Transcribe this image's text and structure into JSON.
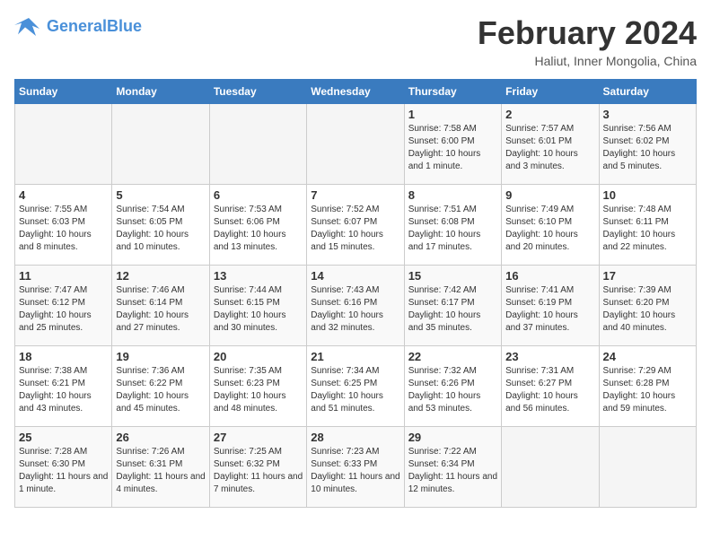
{
  "app": {
    "name": "GeneralBlue",
    "logo_color": "#4a90d9"
  },
  "header": {
    "month": "February 2024",
    "location": "Haliut, Inner Mongolia, China"
  },
  "weekdays": [
    "Sunday",
    "Monday",
    "Tuesday",
    "Wednesday",
    "Thursday",
    "Friday",
    "Saturday"
  ],
  "weeks": [
    [
      {
        "day": "",
        "info": ""
      },
      {
        "day": "",
        "info": ""
      },
      {
        "day": "",
        "info": ""
      },
      {
        "day": "",
        "info": ""
      },
      {
        "day": "1",
        "info": "Sunrise: 7:58 AM\nSunset: 6:00 PM\nDaylight: 10 hours and 1 minute."
      },
      {
        "day": "2",
        "info": "Sunrise: 7:57 AM\nSunset: 6:01 PM\nDaylight: 10 hours and 3 minutes."
      },
      {
        "day": "3",
        "info": "Sunrise: 7:56 AM\nSunset: 6:02 PM\nDaylight: 10 hours and 5 minutes."
      }
    ],
    [
      {
        "day": "4",
        "info": "Sunrise: 7:55 AM\nSunset: 6:03 PM\nDaylight: 10 hours and 8 minutes."
      },
      {
        "day": "5",
        "info": "Sunrise: 7:54 AM\nSunset: 6:05 PM\nDaylight: 10 hours and 10 minutes."
      },
      {
        "day": "6",
        "info": "Sunrise: 7:53 AM\nSunset: 6:06 PM\nDaylight: 10 hours and 13 minutes."
      },
      {
        "day": "7",
        "info": "Sunrise: 7:52 AM\nSunset: 6:07 PM\nDaylight: 10 hours and 15 minutes."
      },
      {
        "day": "8",
        "info": "Sunrise: 7:51 AM\nSunset: 6:08 PM\nDaylight: 10 hours and 17 minutes."
      },
      {
        "day": "9",
        "info": "Sunrise: 7:49 AM\nSunset: 6:10 PM\nDaylight: 10 hours and 20 minutes."
      },
      {
        "day": "10",
        "info": "Sunrise: 7:48 AM\nSunset: 6:11 PM\nDaylight: 10 hours and 22 minutes."
      }
    ],
    [
      {
        "day": "11",
        "info": "Sunrise: 7:47 AM\nSunset: 6:12 PM\nDaylight: 10 hours and 25 minutes."
      },
      {
        "day": "12",
        "info": "Sunrise: 7:46 AM\nSunset: 6:14 PM\nDaylight: 10 hours and 27 minutes."
      },
      {
        "day": "13",
        "info": "Sunrise: 7:44 AM\nSunset: 6:15 PM\nDaylight: 10 hours and 30 minutes."
      },
      {
        "day": "14",
        "info": "Sunrise: 7:43 AM\nSunset: 6:16 PM\nDaylight: 10 hours and 32 minutes."
      },
      {
        "day": "15",
        "info": "Sunrise: 7:42 AM\nSunset: 6:17 PM\nDaylight: 10 hours and 35 minutes."
      },
      {
        "day": "16",
        "info": "Sunrise: 7:41 AM\nSunset: 6:19 PM\nDaylight: 10 hours and 37 minutes."
      },
      {
        "day": "17",
        "info": "Sunrise: 7:39 AM\nSunset: 6:20 PM\nDaylight: 10 hours and 40 minutes."
      }
    ],
    [
      {
        "day": "18",
        "info": "Sunrise: 7:38 AM\nSunset: 6:21 PM\nDaylight: 10 hours and 43 minutes."
      },
      {
        "day": "19",
        "info": "Sunrise: 7:36 AM\nSunset: 6:22 PM\nDaylight: 10 hours and 45 minutes."
      },
      {
        "day": "20",
        "info": "Sunrise: 7:35 AM\nSunset: 6:23 PM\nDaylight: 10 hours and 48 minutes."
      },
      {
        "day": "21",
        "info": "Sunrise: 7:34 AM\nSunset: 6:25 PM\nDaylight: 10 hours and 51 minutes."
      },
      {
        "day": "22",
        "info": "Sunrise: 7:32 AM\nSunset: 6:26 PM\nDaylight: 10 hours and 53 minutes."
      },
      {
        "day": "23",
        "info": "Sunrise: 7:31 AM\nSunset: 6:27 PM\nDaylight: 10 hours and 56 minutes."
      },
      {
        "day": "24",
        "info": "Sunrise: 7:29 AM\nSunset: 6:28 PM\nDaylight: 10 hours and 59 minutes."
      }
    ],
    [
      {
        "day": "25",
        "info": "Sunrise: 7:28 AM\nSunset: 6:30 PM\nDaylight: 11 hours and 1 minute."
      },
      {
        "day": "26",
        "info": "Sunrise: 7:26 AM\nSunset: 6:31 PM\nDaylight: 11 hours and 4 minutes."
      },
      {
        "day": "27",
        "info": "Sunrise: 7:25 AM\nSunset: 6:32 PM\nDaylight: 11 hours and 7 minutes."
      },
      {
        "day": "28",
        "info": "Sunrise: 7:23 AM\nSunset: 6:33 PM\nDaylight: 11 hours and 10 minutes."
      },
      {
        "day": "29",
        "info": "Sunrise: 7:22 AM\nSunset: 6:34 PM\nDaylight: 11 hours and 12 minutes."
      },
      {
        "day": "",
        "info": ""
      },
      {
        "day": "",
        "info": ""
      }
    ]
  ]
}
